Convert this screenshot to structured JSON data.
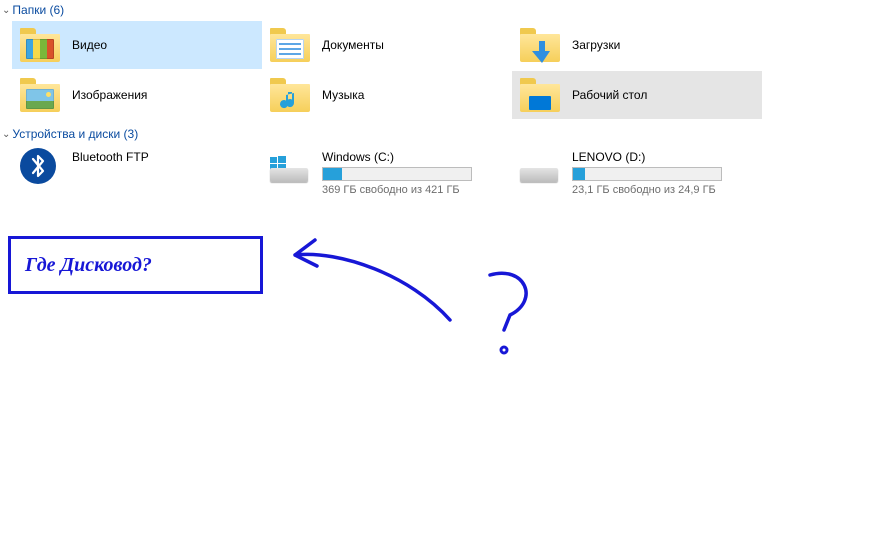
{
  "sections": {
    "folders": {
      "title": "Папки (6)",
      "items": [
        {
          "label": "Видео",
          "icon": "video",
          "state": "selected"
        },
        {
          "label": "Документы",
          "icon": "docs",
          "state": ""
        },
        {
          "label": "Загрузки",
          "icon": "downloads",
          "state": ""
        },
        {
          "label": "Изображения",
          "icon": "images",
          "state": ""
        },
        {
          "label": "Музыка",
          "icon": "music",
          "state": ""
        },
        {
          "label": "Рабочий стол",
          "icon": "desktop",
          "state": "hover"
        }
      ]
    },
    "devices": {
      "title": "Устройства и диски (3)",
      "items": [
        {
          "type": "bluetooth",
          "label": "Bluetooth FTP"
        },
        {
          "type": "drive",
          "label": "Windows (C:)",
          "free_text": "369 ГБ свободно из 421 ГБ",
          "fill_pct": 13,
          "os_badge": true
        },
        {
          "type": "drive",
          "label": "LENOVO (D:)",
          "free_text": "23,1 ГБ свободно из 24,9 ГБ",
          "fill_pct": 8,
          "os_badge": false
        }
      ]
    }
  },
  "annotation": {
    "text": "Где Дисковод?"
  }
}
